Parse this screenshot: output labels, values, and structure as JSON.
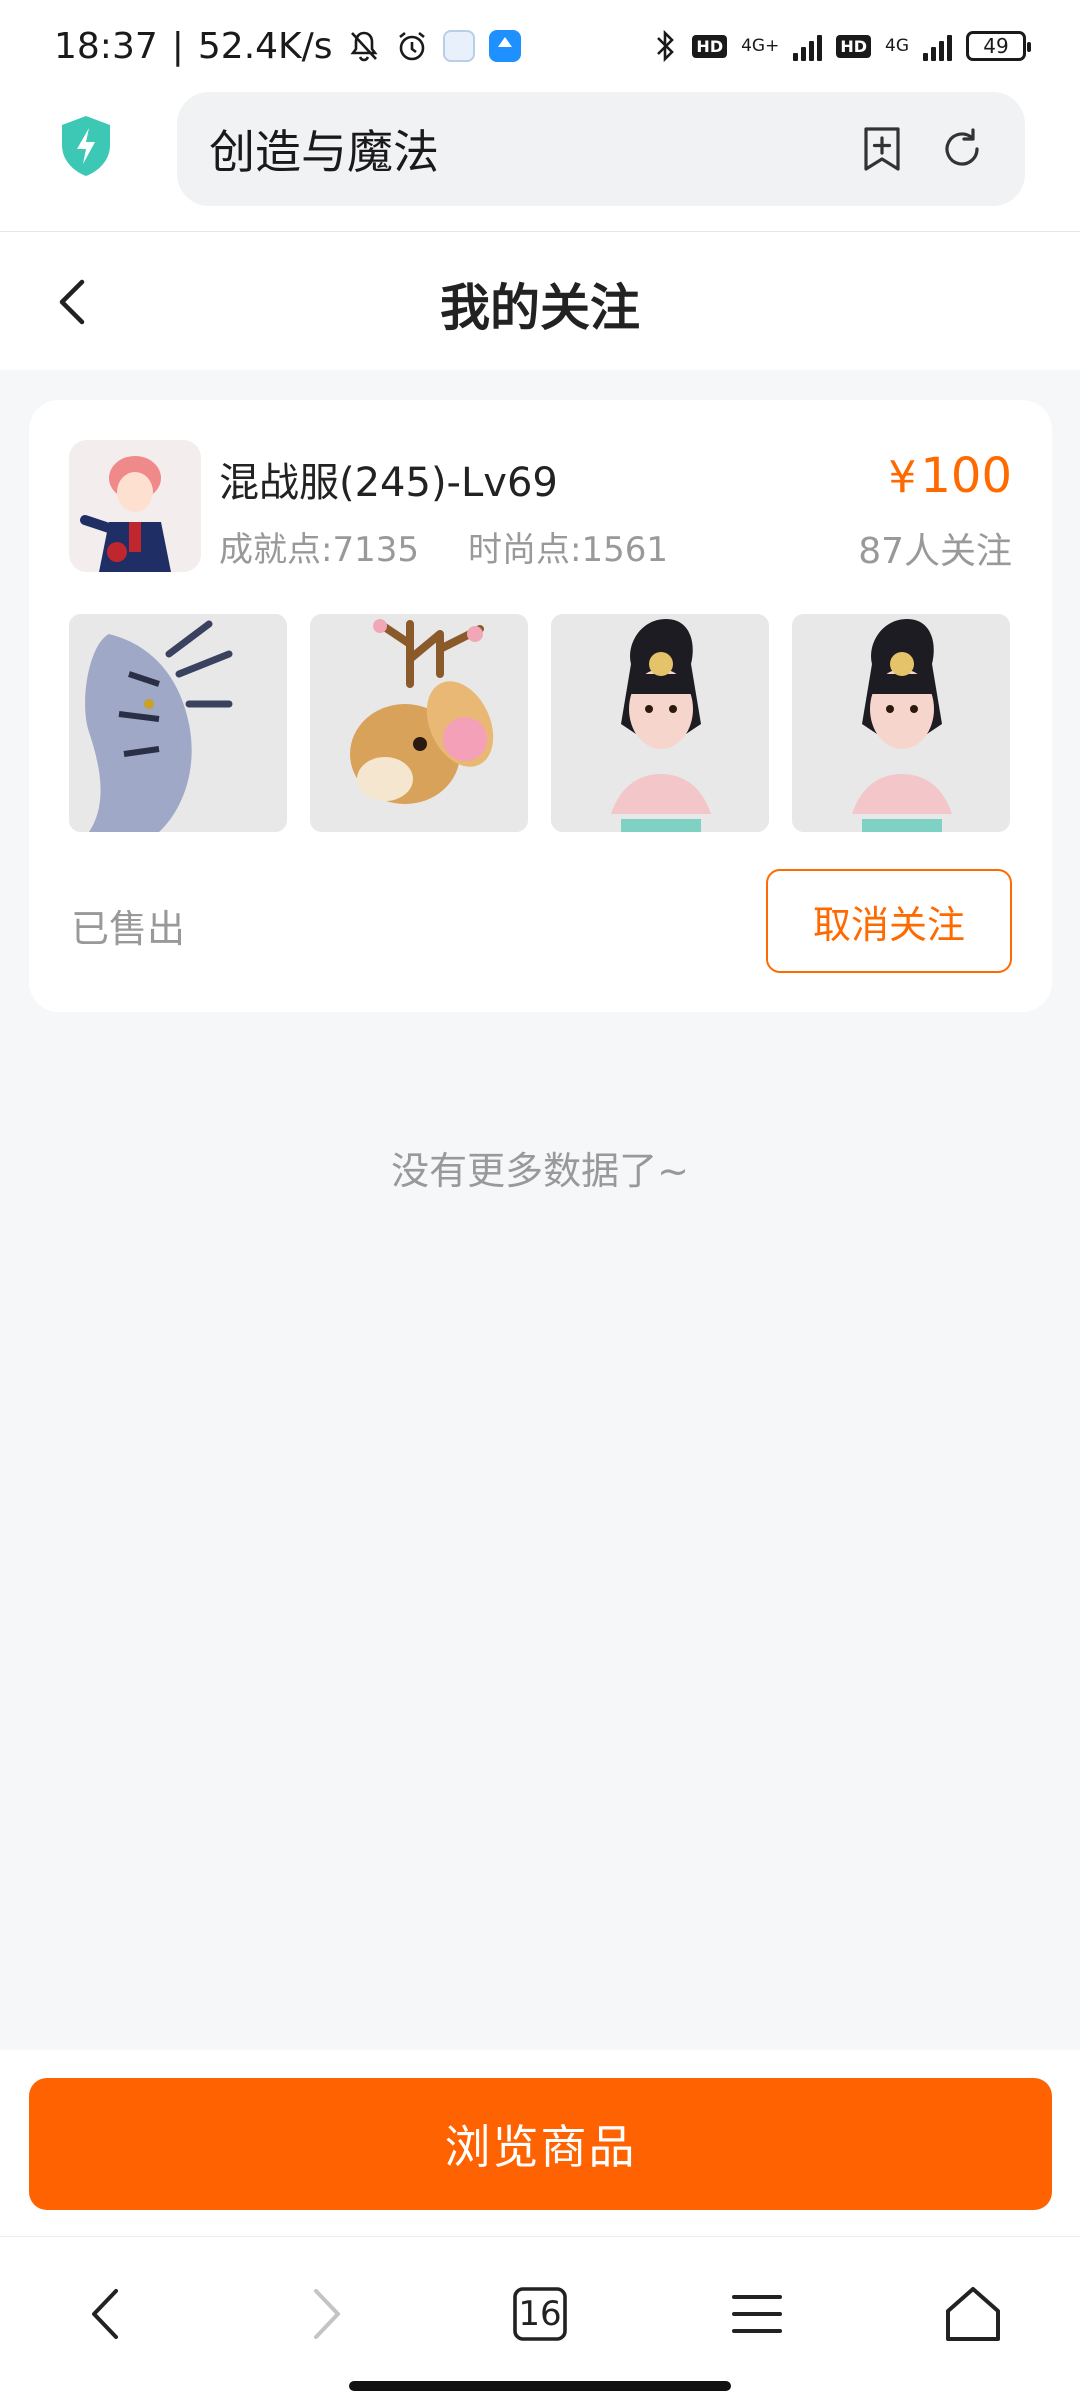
{
  "status_bar": {
    "time": "18:37",
    "net_speed": "52.4K/s",
    "net1": "4G+",
    "net2": "4G",
    "hd": "HD",
    "battery": "49"
  },
  "browser": {
    "address": "创造与魔法"
  },
  "header": {
    "title": "我的关注"
  },
  "listing": {
    "server": "混战服(245)-Lv69",
    "achievement": "成就点:7135",
    "fashion": "时尚点:1561",
    "price_symbol": "¥",
    "price_value": "100",
    "followers": "87人关注",
    "status": "已售出",
    "unfollow_label": "取消关注"
  },
  "list_end_text": "没有更多数据了~",
  "cta": {
    "browse_label": "浏览商品"
  },
  "browser_nav": {
    "tab_count": "16"
  },
  "colors": {
    "accent": "#ff6200",
    "price": "#ff6a00",
    "muted_text": "#999999",
    "background": "#f6f7f9"
  }
}
